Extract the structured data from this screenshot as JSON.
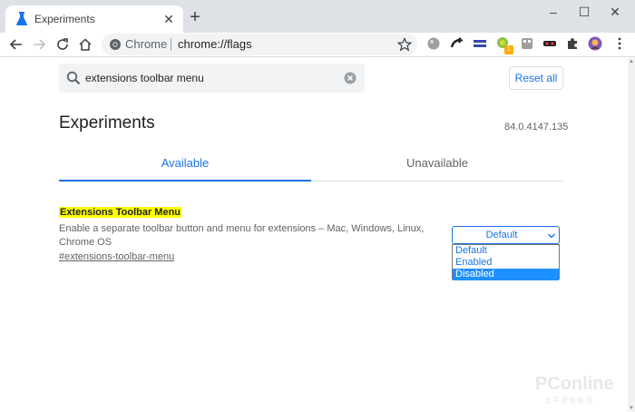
{
  "browser": {
    "tab_title": "Experiments",
    "close_glyph": "✕",
    "new_tab_glyph": "+",
    "window_controls": [
      "–",
      "☐",
      "✕"
    ],
    "omnibox_chip": "Chrome",
    "omnibox_url": "chrome://flags"
  },
  "search": {
    "value": "extensions toolbar menu"
  },
  "reset_label": "Reset all",
  "page": {
    "title": "Experiments",
    "version": "84.0.4147.135"
  },
  "tabs": {
    "available": "Available",
    "unavailable": "Unavailable"
  },
  "flag": {
    "name": "Extensions Toolbar Menu",
    "description": "Enable a separate toolbar button and menu for extensions – Mac, Windows, Linux, Chrome OS",
    "link": "#extensions-toolbar-menu",
    "selected_value": "Default",
    "options": [
      "Default",
      "Enabled",
      "Disabled"
    ],
    "highlighted_option": "Disabled"
  },
  "extension_badge": "1",
  "watermark": {
    "main": "PConline",
    "sub": "太平洋电脑网"
  },
  "colors": {
    "accent": "#1a73e8",
    "highlight": "#ffff00",
    "tabstrip": "#dee1e6",
    "selected_option": "#1e90ff"
  },
  "icons": [
    "flask-icon",
    "close-icon",
    "plus-icon",
    "minimize-icon",
    "maximize-icon",
    "back-icon",
    "forward-icon",
    "reload-icon",
    "home-icon",
    "chrome-icon",
    "star-icon",
    "puzzle-icon",
    "avatar",
    "menu-icon",
    "search-icon",
    "clear-icon",
    "chevron-down-icon"
  ]
}
